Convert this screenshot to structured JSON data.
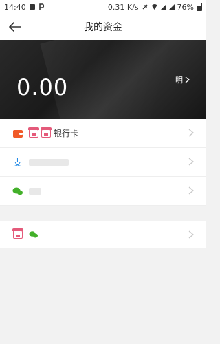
{
  "status_bar": {
    "time": "14:40",
    "speed": "0.31 K/s",
    "battery": "76%"
  },
  "header": {
    "title": "我的资金"
  },
  "balance": {
    "amount": "0.00",
    "detail_label": "明"
  },
  "list": [
    {
      "icon": "wallet-icon",
      "label": "银行卡"
    },
    {
      "icon": "alipay-icon",
      "label": ""
    },
    {
      "icon": "wechat-icon",
      "label": ""
    },
    {
      "icon": "store-icon",
      "label": ""
    }
  ],
  "colors": {
    "accent_orange": "#f05a28",
    "alipay_blue": "#1e88e5",
    "wechat_green": "#43b02a",
    "store_pink": "#e45a7a"
  }
}
